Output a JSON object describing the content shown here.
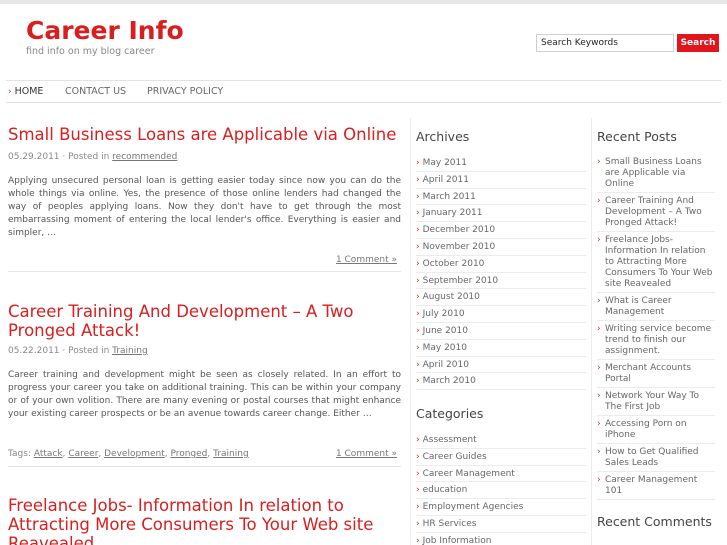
{
  "site": {
    "title": "Career Info",
    "tagline": "find info on my blog career"
  },
  "search": {
    "placeholder": "Search Keywords",
    "value": "Search Keywords",
    "button_label": "Search"
  },
  "nav": {
    "items": [
      {
        "label": "HOME",
        "active": true
      },
      {
        "label": "CONTACT US",
        "active": false
      },
      {
        "label": "PRIVACY POLICY",
        "active": false
      }
    ]
  },
  "posts": [
    {
      "title": "Small Business Loans are Applicable via Online",
      "date": "05.29.2011",
      "posted_in_prefix": "· Posted in",
      "category": "recommended",
      "excerpt": "Applying unsecured personal loan is getting easier today since now you can do the whole things via online. Yes, the presence of those online lenders had changed the way of peoples applying loans. Now they don't have to get through the most embarrassing moment of entering the local lender's office. Everything is easier and simpler, …",
      "comments": "1 Comment »"
    },
    {
      "title": "Career Training And Development – A Two Pronged Attack!",
      "date": "05.22.2011",
      "posted_in_prefix": "· Posted in",
      "category": "Training",
      "excerpt": "Career training and development might be seen as closely related. In an effort to progress your career you take on additional training. This can be within your company or of your own volition. There are many evening or postal courses that might enhance your existing career prospects or be an avenue towards career change. Either …",
      "tags_label": "Tags:",
      "tags": [
        "Attack",
        "Career",
        "Development",
        "Pronged",
        "Training"
      ],
      "comments": "1 Comment »"
    },
    {
      "title": "Freelance Jobs- Information In relation to Attracting More Consumers To Your Web site Reavealed"
    }
  ],
  "archives": {
    "heading": "Archives",
    "items": [
      "May 2011",
      "April 2011",
      "March 2011",
      "January 2011",
      "December 2010",
      "November 2010",
      "October 2010",
      "September 2010",
      "August 2010",
      "July 2010",
      "June 2010",
      "May 2010",
      "April 2010",
      "March 2010"
    ]
  },
  "categories": {
    "heading": "Categories",
    "items": [
      "Assessment",
      "Career Guides",
      "Career Management",
      "education",
      "Employment Agencies",
      "HR Services",
      "Job Information"
    ]
  },
  "recent_posts": {
    "heading": "Recent Posts",
    "items": [
      "Small Business Loans are Applicable via Online",
      "Career Training And Development – A Two Pronged Attack!",
      "Freelance Jobs- Information In relation to Attracting More Consumers To Your Web site Reavealed",
      "What is Career Management",
      "Writing service become trend to finish our assignment.",
      "Merchant Accounts Portal",
      "Network Your Way To The First Job",
      "Accessing Porn on iPhone",
      "How to Get Qualified Sales Leads",
      "Career Management 101"
    ]
  },
  "recent_comments": {
    "heading": "Recent Comments"
  },
  "colors": {
    "accent": "#d81e1e",
    "search_button": "#e0161c"
  }
}
